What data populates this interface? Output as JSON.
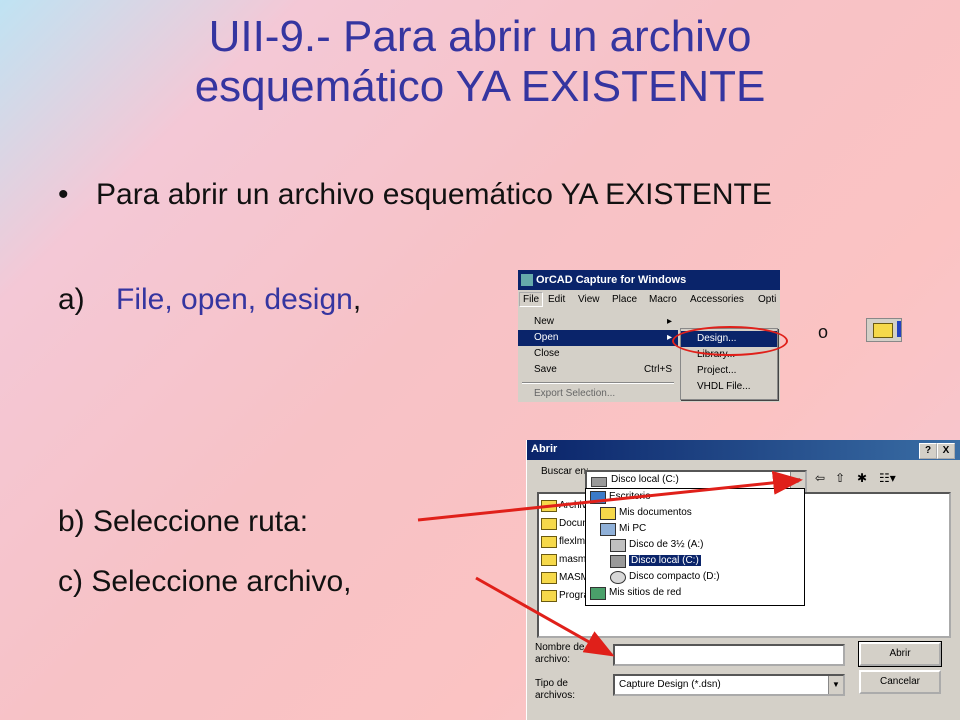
{
  "slide": {
    "title_line1": "UII-9.- Para abrir un archivo",
    "title_line2": "esquemático YA EXISTENTE",
    "bullet_symbol": "•",
    "bullet": "Para abrir un archivo esquemático YA EXISTENTE",
    "step_a_label": "a)",
    "step_a_text": "File, open, design",
    "step_a_comma": ",",
    "step_b": "b) Seleccione ruta:",
    "step_c": "c) Seleccione archivo,",
    "or_text": "o"
  },
  "orcad": {
    "title": "OrCAD Capture for Windows",
    "menubar": [
      "File",
      "Edit",
      "View",
      "Place",
      "Macro",
      "Accessories",
      "Opti"
    ],
    "file_menu": [
      {
        "label": "New",
        "shortcut": "▸"
      },
      {
        "label": "Open",
        "shortcut": "▸"
      },
      {
        "label": "Close",
        "shortcut": ""
      },
      {
        "label": "Save",
        "shortcut": "Ctrl+S"
      },
      {
        "label": "Export Selection...",
        "shortcut": ""
      }
    ],
    "open_submenu": [
      "Design...",
      "Library...",
      "Project...",
      "VHDL File..."
    ]
  },
  "dialog": {
    "title": "Abrir",
    "help_btn": "?",
    "close_btn": "X",
    "buscar_label": "Buscar en:",
    "look_in_value": "Disco local (C:)",
    "combo_arrow": "▼",
    "nav_back": "⇦",
    "nav_up": "⇧",
    "nav_newfolder": "✱",
    "nav_view": "☷▾",
    "folders": [
      "Archiv",
      "Docun",
      "flexlm",
      "masm",
      "MASM",
      "Progra"
    ],
    "dropdown": [
      {
        "label": "Escritorio",
        "indent": 0,
        "icon_color": "#3a7ac8"
      },
      {
        "label": "Mis documentos",
        "indent": 1,
        "icon_color": "#f6d94a"
      },
      {
        "label": "Mi PC",
        "indent": 1,
        "icon_color": "#8fb0d8"
      },
      {
        "label": "Disco de 3½ (A:)",
        "indent": 2,
        "icon_color": "#c0c0c0"
      },
      {
        "label": "Disco local (C:)",
        "indent": 2,
        "icon_color": "#999999",
        "selected": true
      },
      {
        "label": "Disco compacto (D:)",
        "indent": 2,
        "icon_color": "#d8d8d8"
      },
      {
        "label": "Mis sitios de red",
        "indent": 0,
        "icon_color": "#4aa06a"
      }
    ],
    "filename_label": "Nombre de archivo:",
    "filename_value": "",
    "filetype_label": "Tipo de archivos:",
    "filetype_value": "Capture Design (*.dsn)",
    "open_button": "Abrir",
    "cancel_button": "Cancelar"
  },
  "colors": {
    "title_blue": "#3535a0",
    "highlight": "#0a246a",
    "arrow_red": "#e0201a"
  }
}
